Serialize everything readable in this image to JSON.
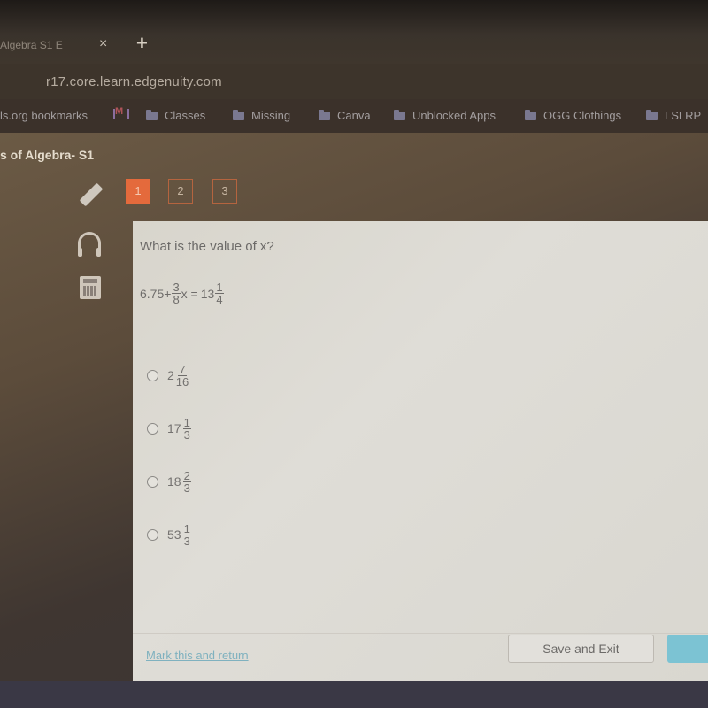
{
  "browser": {
    "tab_title": "Algebra S1 E",
    "tab_close_icon": "×",
    "new_tab_icon": "+",
    "url": "r17.core.learn.edgenuity.com"
  },
  "bookmarks": [
    {
      "label": "ls.org bookmarks",
      "icon": "none"
    },
    {
      "label": "",
      "icon": "gmail-icon"
    },
    {
      "label": "Classes",
      "icon": "folder-icon"
    },
    {
      "label": "Missing",
      "icon": "folder-icon"
    },
    {
      "label": "Canva",
      "icon": "folder-icon"
    },
    {
      "label": "Unblocked Apps",
      "icon": "folder-icon"
    },
    {
      "label": "OGG Clothings",
      "icon": "folder-icon"
    },
    {
      "label": "LSLRP",
      "icon": "folder-icon"
    }
  ],
  "course": {
    "title": "s of Algebra- S1"
  },
  "question_nav": [
    {
      "label": "1",
      "active": true
    },
    {
      "label": "2",
      "active": false
    },
    {
      "label": "3",
      "active": false
    }
  ],
  "sidebar_tools": [
    "pencil-icon",
    "headphones-icon",
    "calculator-icon"
  ],
  "question": {
    "prompt": "What is the value of x?",
    "equation": {
      "constant": "6.75+",
      "coef_num": "3",
      "coef_den": "8",
      "var_eq": "x =",
      "rhs_whole": "13",
      "rhs_num": "1",
      "rhs_den": "4"
    },
    "choices": [
      {
        "whole": "2",
        "num": "7",
        "den": "16"
      },
      {
        "whole": "17",
        "num": "1",
        "den": "3"
      },
      {
        "whole": "18",
        "num": "2",
        "den": "3"
      },
      {
        "whole": "53",
        "num": "1",
        "den": "3"
      }
    ]
  },
  "footer": {
    "mark_link": "Mark this and return",
    "save_exit": "Save and Exit"
  },
  "colors": {
    "active_question": "#e46a3c",
    "link": "#7fb1bf",
    "submit": "#7cc3d3"
  }
}
